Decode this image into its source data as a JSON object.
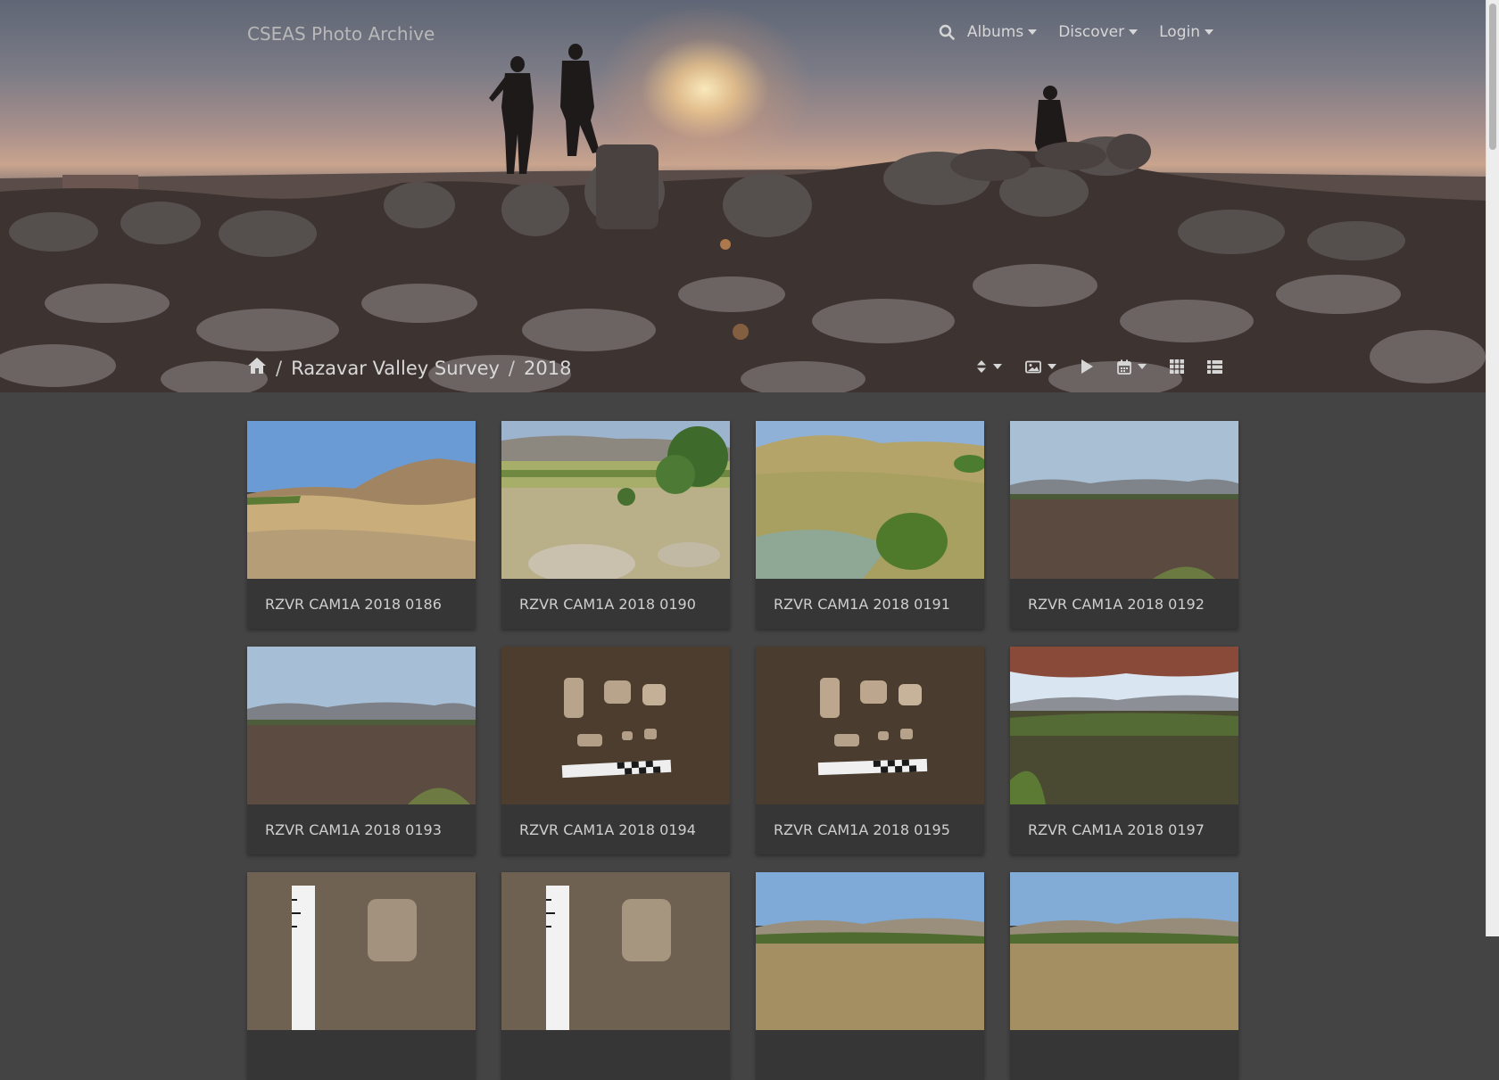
{
  "site": {
    "brand": "CSEAS Photo Archive"
  },
  "nav": {
    "search_icon": "search-icon",
    "items": [
      {
        "label": "Albums"
      },
      {
        "label": "Discover"
      },
      {
        "label": "Login"
      }
    ]
  },
  "breadcrumb": {
    "home_icon": "home-icon",
    "items": [
      {
        "label": "Razavar Valley Survey"
      },
      {
        "label": "2018"
      }
    ]
  },
  "toolbar": {
    "icons": [
      "sort-icon",
      "image-size-icon",
      "play-slideshow-icon",
      "calendar-icon",
      "grid-view-icon",
      "list-view-icon"
    ]
  },
  "photos": [
    {
      "title": "RZVR CAM1A 2018 0186"
    },
    {
      "title": "RZVR CAM1A 2018 0190"
    },
    {
      "title": "RZVR CAM1A 2018 0191"
    },
    {
      "title": "RZVR CAM1A 2018 0192"
    },
    {
      "title": "RZVR CAM1A 2018 0193"
    },
    {
      "title": "RZVR CAM1A 2018 0194"
    },
    {
      "title": "RZVR CAM1A 2018 0195"
    },
    {
      "title": "RZVR CAM1A 2018 0197"
    },
    {
      "title": ""
    },
    {
      "title": ""
    },
    {
      "title": ""
    },
    {
      "title": ""
    }
  ],
  "colors": {
    "background": "#444444",
    "card": "#363636",
    "text": "#cfcfcf"
  }
}
